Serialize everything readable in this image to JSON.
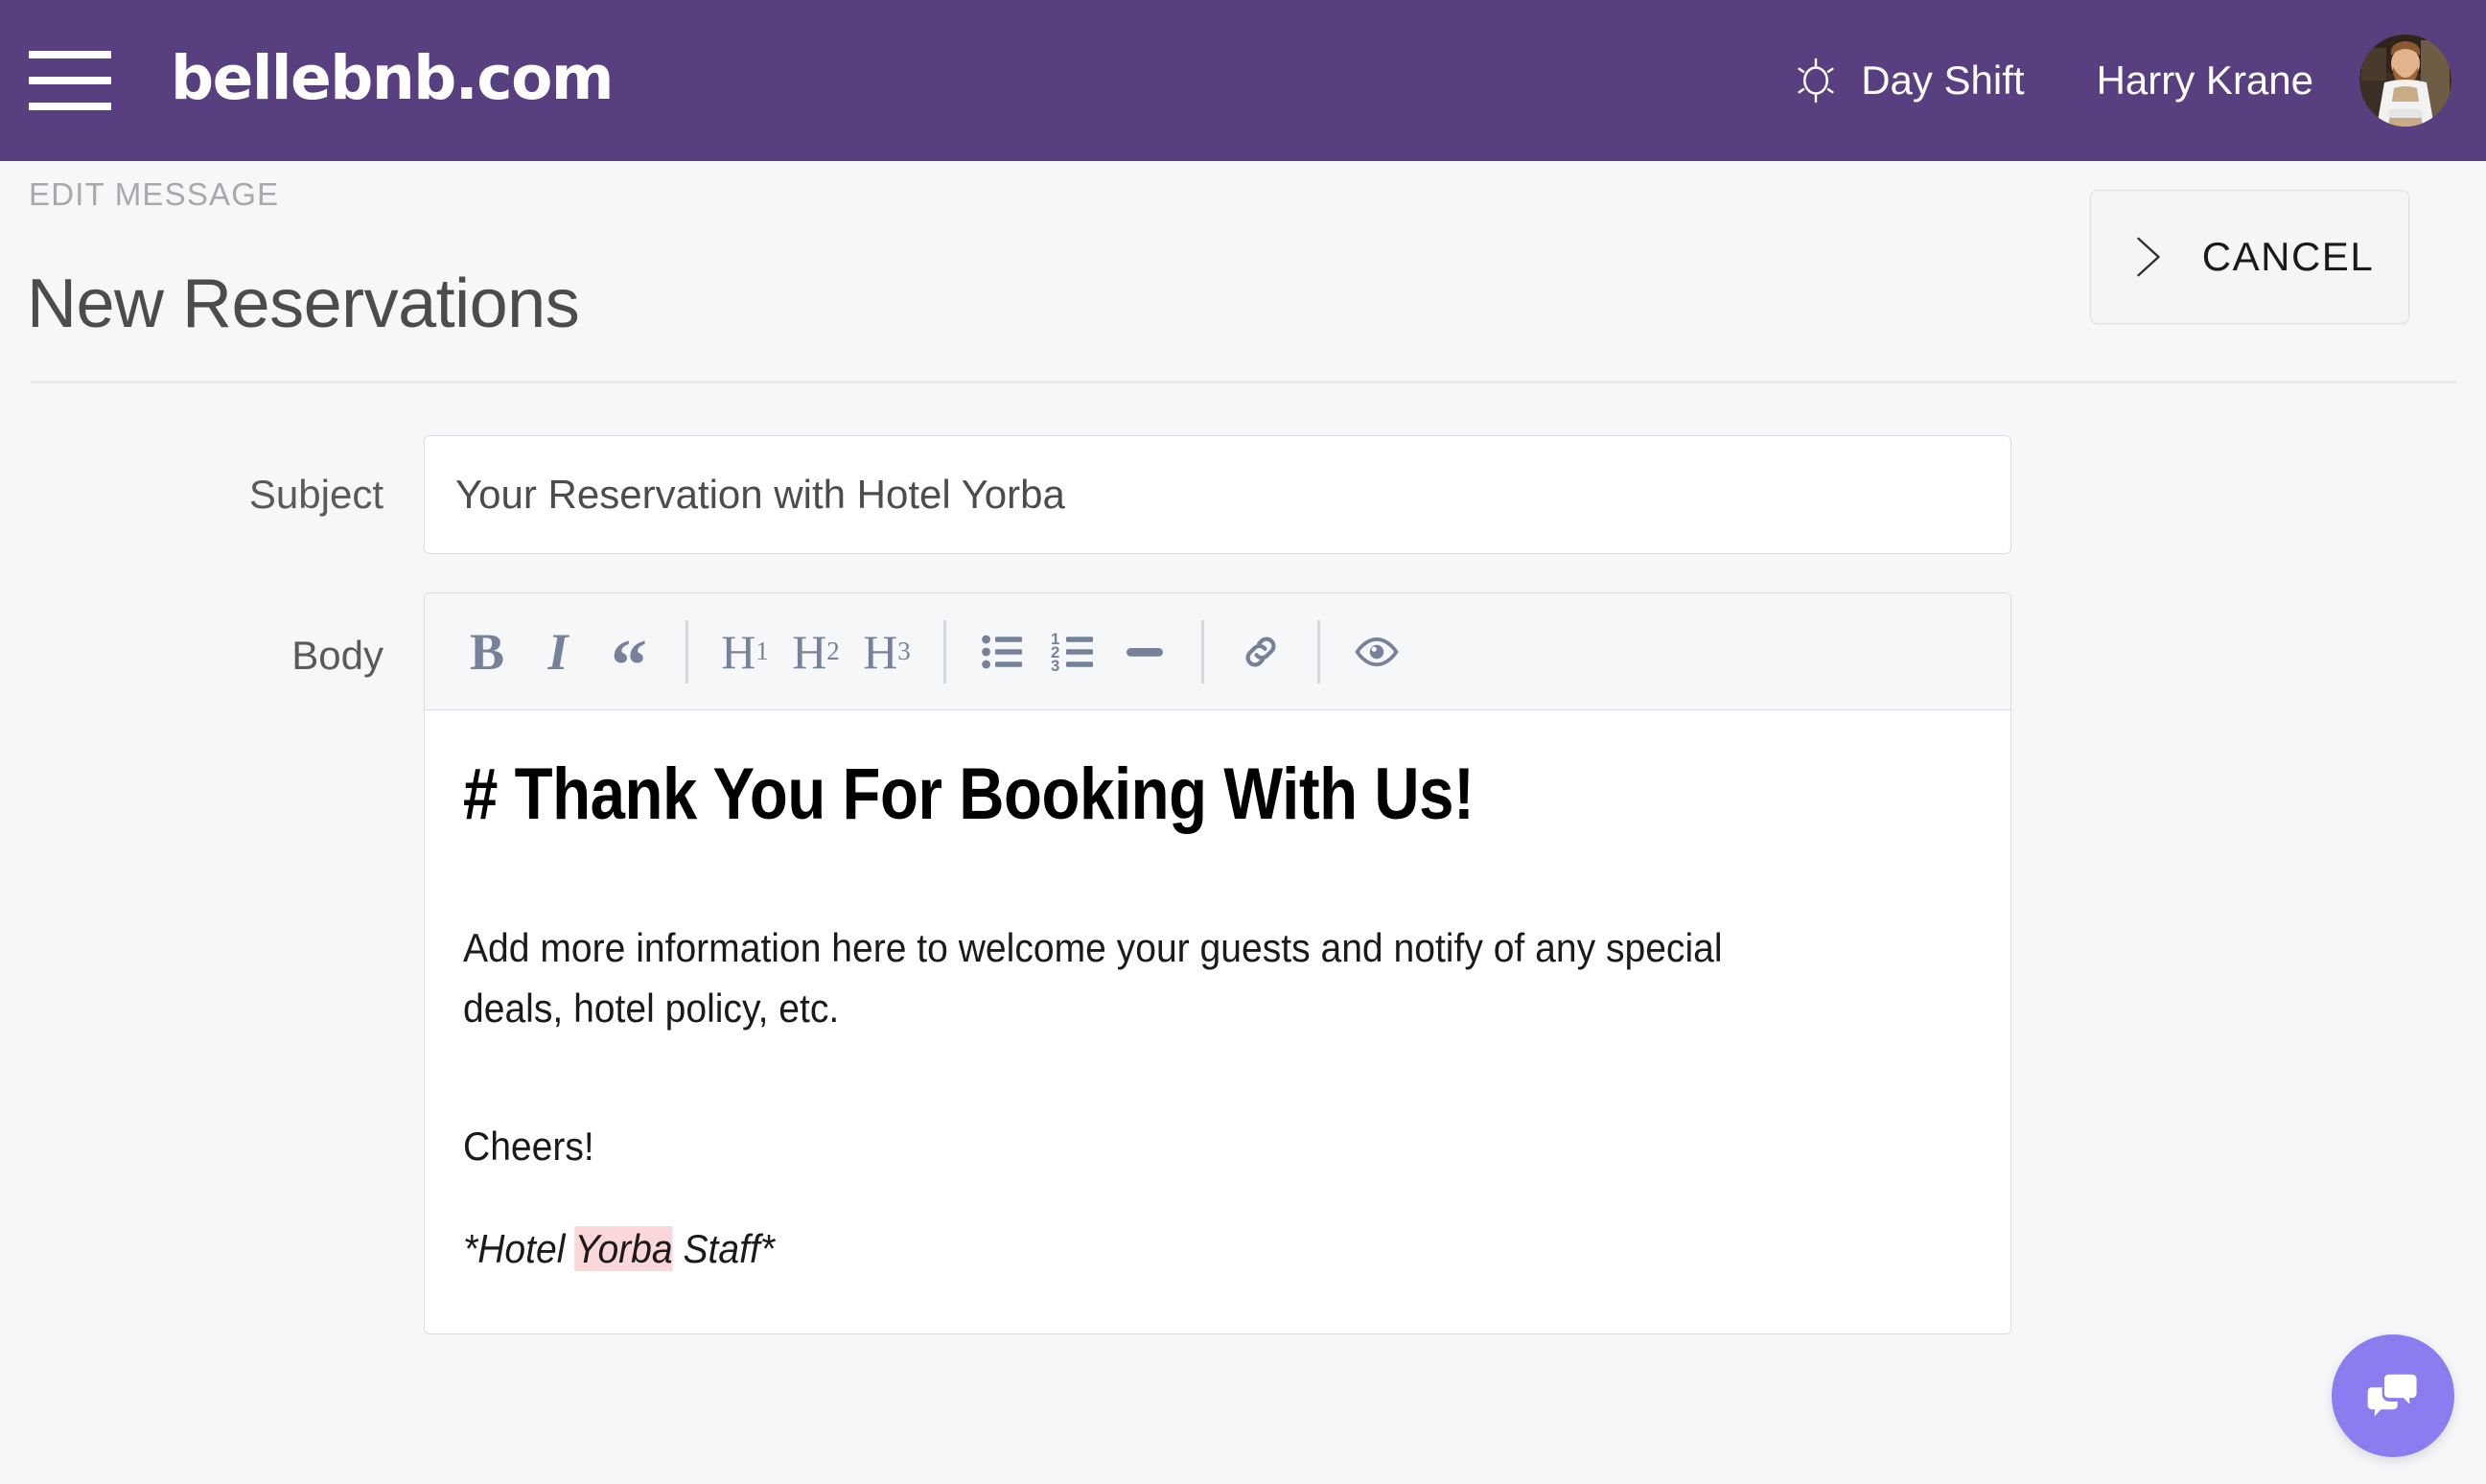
{
  "topbar": {
    "menu_icon": "hamburger-menu-icon",
    "brand": "bellebnb.com",
    "shift_icon": "sun-icon",
    "shift_label": "Day Shift",
    "user_name": "Harry Krane",
    "avatar_icon": "user-avatar",
    "background_color": "#584080"
  },
  "page_header": {
    "eyebrow": "EDIT MESSAGE",
    "title": "New Reservations",
    "cancel_icon": "chevron-right-icon",
    "cancel_label": "CANCEL"
  },
  "form": {
    "subject": {
      "label": "Subject",
      "value": "Your Reservation with Hotel Yorba",
      "placeholder": "Subject"
    },
    "body": {
      "label": "Body",
      "toolbar": [
        {
          "name": "bold-button",
          "label": "B"
        },
        {
          "name": "italic-button",
          "label": "I"
        },
        {
          "name": "blockquote-button",
          "label": "“"
        },
        {
          "name": "heading-1-button",
          "label": "H",
          "sub": "1"
        },
        {
          "name": "heading-2-button",
          "label": "H",
          "sub": "2"
        },
        {
          "name": "heading-3-button",
          "label": "H",
          "sub": "3"
        },
        {
          "name": "unordered-list-button",
          "label": ""
        },
        {
          "name": "ordered-list-button",
          "label": ""
        },
        {
          "name": "horizontal-rule-button",
          "label": ""
        },
        {
          "name": "link-button",
          "label": ""
        },
        {
          "name": "preview-button",
          "label": ""
        }
      ],
      "content": {
        "heading": "# Thank You For Booking With Us!",
        "paragraph": "Add more information here to welcome your guests and notify of any special deals, hotel policy, etc.",
        "closing": "Cheers!",
        "signature_before": "*Hotel ",
        "signature_highlight": "Yorba",
        "signature_after": " Staff*",
        "highlight_color": "#fcd7d9"
      }
    }
  },
  "chat": {
    "icon": "chat-bubbles-icon",
    "color": "#8b7cf0"
  }
}
